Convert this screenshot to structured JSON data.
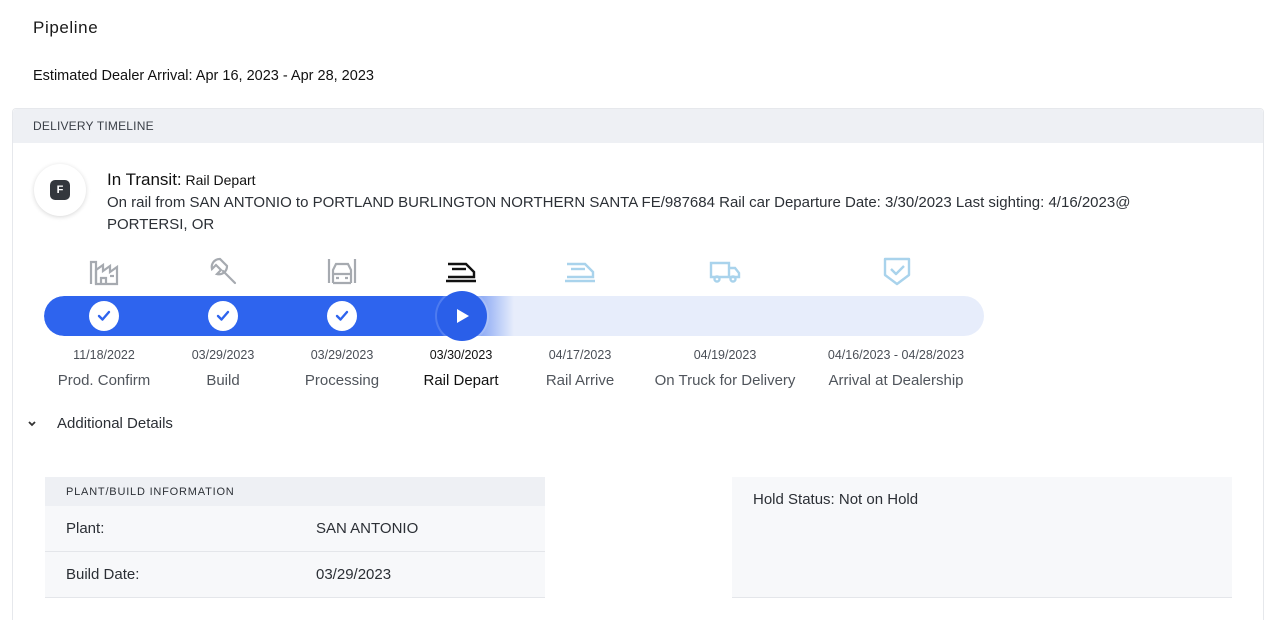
{
  "page": {
    "title": "Pipeline",
    "eta": "Estimated Dealer Arrival: Apr 16, 2023 - Apr 28, 2023"
  },
  "timeline": {
    "header": "DELIVERY TIMELINE",
    "badge": "F",
    "status_label": "In Transit:",
    "status_value": "Rail Depart",
    "description": "On rail from SAN ANTONIO to PORTLAND BURLINGTON NORTHERN SANTA FE/987684 Rail car Departure Date: 3/30/2023 Last sighting: 4/16/2023@ PORTERSI, OR",
    "progress_fraction": 0.5,
    "stages": [
      {
        "name": "Prod. Confirm",
        "date": "11/18/2022",
        "icon": "factory-icon",
        "state": "complete"
      },
      {
        "name": "Build",
        "date": "03/29/2023",
        "icon": "wrench-icon",
        "state": "complete"
      },
      {
        "name": "Processing",
        "date": "03/29/2023",
        "icon": "vehicle-front-icon",
        "state": "complete"
      },
      {
        "name": "Rail Depart",
        "date": "03/30/2023",
        "icon": "train-icon",
        "state": "current"
      },
      {
        "name": "Rail Arrive",
        "date": "04/17/2023",
        "icon": "train-icon",
        "state": "upcoming"
      },
      {
        "name": "On Truck for Delivery",
        "date": "04/19/2023",
        "icon": "truck-icon",
        "state": "upcoming"
      },
      {
        "name": "Arrival at Dealership",
        "date": "04/16/2023 - 04/28/2023",
        "icon": "shield-check-icon",
        "state": "upcoming"
      }
    ],
    "colors": {
      "progress": "#2e64ee",
      "track": "#e7edfb",
      "upcoming_icon": "#a9d3ec",
      "complete_icon": "#a6aab0",
      "current_icon": "#111111"
    }
  },
  "details": {
    "toggle_label": "Additional Details",
    "plant_card": {
      "header": "PLANT/BUILD INFORMATION",
      "rows": [
        {
          "label": "Plant:",
          "value": "SAN ANTONIO"
        },
        {
          "label": "Build Date:",
          "value": "03/29/2023"
        }
      ]
    },
    "hold_status": "Hold Status: Not on Hold"
  }
}
